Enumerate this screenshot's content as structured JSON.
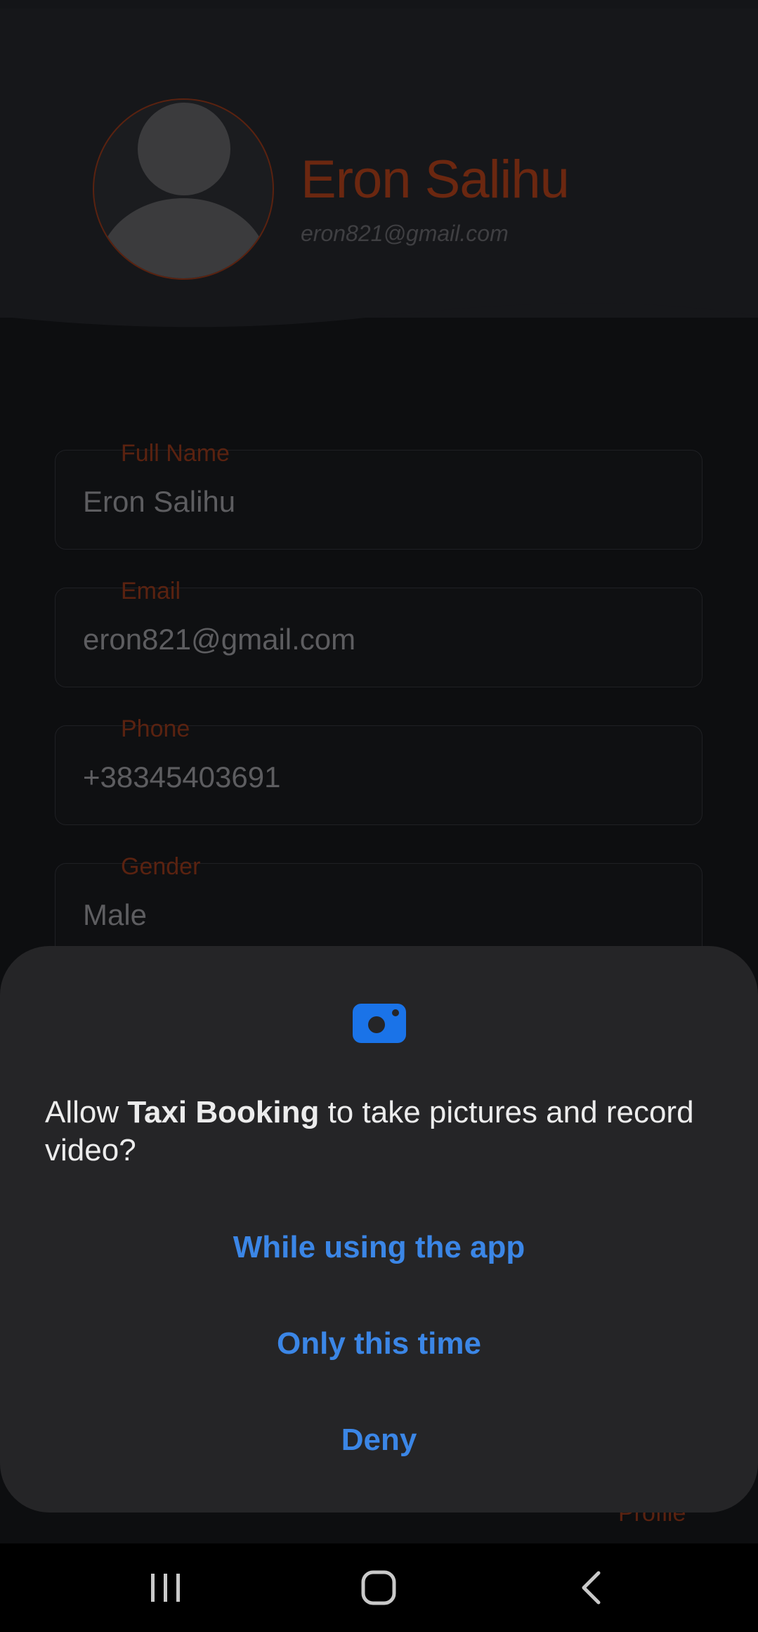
{
  "profile": {
    "name": "Eron Salihu",
    "email": "eron821@gmail.com"
  },
  "fields": [
    {
      "label": "Full Name",
      "value": "Eron Salihu"
    },
    {
      "label": "Email",
      "value": "eron821@gmail.com"
    },
    {
      "label": "Phone",
      "value": "+38345403691"
    },
    {
      "label": "Gender",
      "value": "Male"
    }
  ],
  "footer": {
    "tab_label": "Profile"
  },
  "dialog": {
    "icon": "camera-icon",
    "prompt_prefix": "Allow ",
    "app_name": "Taxi Booking",
    "prompt_suffix": " to take pictures and record video?",
    "actions": {
      "while_using": "While using the app",
      "only_this_time": "Only this time",
      "deny": "Deny"
    }
  },
  "nav": {
    "recents": "recents-icon",
    "home": "home-icon",
    "back": "back-icon"
  },
  "colors": {
    "accent": "#6b2710",
    "dialog_action": "#3b86e6",
    "dialog_bg": "#252527"
  }
}
